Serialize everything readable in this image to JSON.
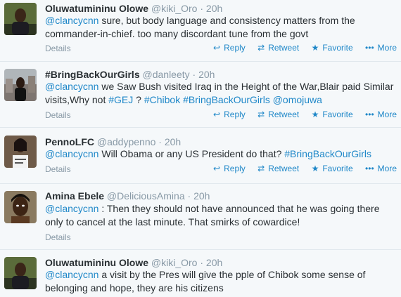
{
  "actions": {
    "details": "Details",
    "reply": "Reply",
    "retweet": "Retweet",
    "favorite": "Favorite",
    "more": "More"
  },
  "tweets": [
    {
      "name": "Oluwatumininu Olowe",
      "handle": "@kiki_Oro",
      "dot": "·",
      "time": "20h",
      "line1": [
        {
          "t": "@clancycnn",
          "link": true
        },
        {
          "t": " sure, but body language and consistency matters from the",
          "link": false
        }
      ],
      "line2": [
        {
          "t": "commander-in-chief. too many discordant tune from the govt",
          "link": false
        }
      ],
      "avatar": "man-portrait"
    },
    {
      "name": "#BringBackOurGirls",
      "handle": "@danleety",
      "dot": "·",
      "time": "20h",
      "line1": [
        {
          "t": "@clancycnn",
          "link": true
        },
        {
          "t": " we Saw Bush visited Iraq in the Height of the War,Blair paid Similar",
          "link": false
        }
      ],
      "line2": [
        {
          "t": "visits,Why not ",
          "link": false
        },
        {
          "t": "#GEJ",
          "link": true
        },
        {
          "t": " ? ",
          "link": false
        },
        {
          "t": "#Chibok",
          "link": true
        },
        {
          "t": " ",
          "link": false
        },
        {
          "t": "#BringBackOurGirls",
          "link": true
        },
        {
          "t": " ",
          "link": false
        },
        {
          "t": "@omojuwa",
          "link": true
        }
      ],
      "avatar": "city-portrait"
    },
    {
      "name": "PennoLFC",
      "handle": "@addypenno",
      "dot": "·",
      "time": "20h",
      "line1": [
        {
          "t": "@clancycnn",
          "link": true
        },
        {
          "t": " Will Obama or any US President do that? ",
          "link": false
        },
        {
          "t": "#BringBackOurGirls",
          "link": true
        }
      ],
      "line2": [],
      "avatar": "sign-portrait"
    },
    {
      "name": "Amina Ebele",
      "handle": "@DeliciousAmina",
      "dot": "·",
      "time": "20h",
      "line1": [
        {
          "t": "@clancycnn",
          "link": true
        },
        {
          "t": " : Then they should not have announced that he was going there",
          "link": false
        }
      ],
      "line2": [
        {
          "t": "only to cancel at the last minute. That smirks of cowardice!",
          "link": false
        }
      ],
      "avatar": "woman-portrait"
    },
    {
      "name": "Oluwatumininu Olowe",
      "handle": "@kiki_Oro",
      "dot": "·",
      "time": "20h",
      "line1": [
        {
          "t": "@clancycnn",
          "link": true
        },
        {
          "t": " a visit by the Pres will give the pple of Chibok some sense of",
          "link": false
        }
      ],
      "line2": [
        {
          "t": "belonging and hope, they are his citizens",
          "link": false
        }
      ],
      "avatar": "man-portrait"
    }
  ],
  "colors": {
    "link": "#1e87c8",
    "muted": "#8899a6",
    "text": "#292f33",
    "background": "#f5f8fa",
    "separator": "#e1e8ed"
  }
}
